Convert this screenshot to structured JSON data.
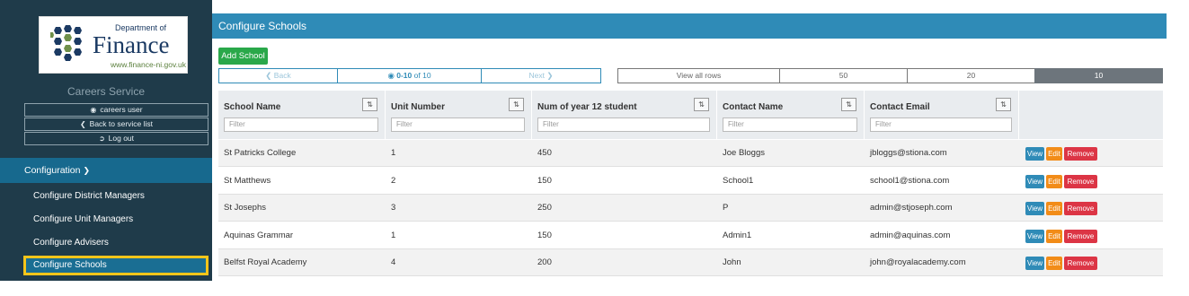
{
  "brand": {
    "dept": "Department of",
    "name": "Finance",
    "url": "www.finance-ni.gov.uk"
  },
  "sidebar": {
    "service_title": "Careers Service",
    "user_label": "careers user",
    "back_label": "Back to service list",
    "logout_label": "Log out",
    "config_label": "Configuration",
    "items": [
      {
        "label": "Configure District Managers"
      },
      {
        "label": "Configure Unit Managers"
      },
      {
        "label": "Configure Advisers"
      },
      {
        "label": "Configure Schools"
      }
    ]
  },
  "page": {
    "title": "Configure Schools",
    "add_label": "Add School"
  },
  "pager": {
    "back": "Back",
    "range": "0-10",
    "of": "of 10",
    "next": "Next"
  },
  "rows_options": [
    "View all rows",
    "50",
    "20",
    "10"
  ],
  "table": {
    "headers": [
      "School Name",
      "Unit Number",
      "Num of year 12 student",
      "Contact Name",
      "Contact Email"
    ],
    "filter_placeholder": "Filter",
    "actions": {
      "view": "View",
      "edit": "Edit",
      "remove": "Remove"
    },
    "rows": [
      [
        "St Patricks College",
        "1",
        "450",
        "Joe Bloggs",
        "jbloggs@stiona.com"
      ],
      [
        "St Matthews",
        "2",
        "150",
        "School1",
        "school1@stiona.com"
      ],
      [
        "St Josephs",
        "3",
        "250",
        "P",
        "admin@stjoseph.com"
      ],
      [
        "Aquinas Grammar",
        "1",
        "150",
        "Admin1",
        "admin@aquinas.com"
      ],
      [
        "Belfst Royal Academy",
        "4",
        "200",
        "John",
        "john@royalacademy.com"
      ]
    ]
  },
  "colors": {
    "sidebar": "#1f3b4a",
    "accent": "#2f8bb7",
    "success": "#2aa84a",
    "warning": "#f28c18",
    "danger": "#dc3545",
    "highlight": "#f5c51a"
  }
}
